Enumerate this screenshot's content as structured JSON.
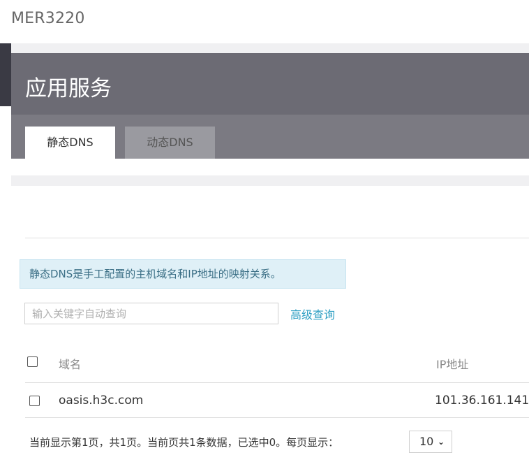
{
  "device": {
    "name": "MER3220"
  },
  "page": {
    "title": "应用服务"
  },
  "tabs": [
    {
      "label": "静态DNS",
      "active": true
    },
    {
      "label": "动态DNS",
      "active": false
    }
  ],
  "info": {
    "text": "静态DNS是手工配置的主机域名和IP地址的映射关系。"
  },
  "search": {
    "placeholder": "输入关键字自动查询",
    "value": "",
    "advanced_label": "高级查询"
  },
  "table": {
    "columns": [
      "域名",
      "IP地址"
    ],
    "rows": [
      {
        "domain": "oasis.h3c.com",
        "ip": "101.36.161.141",
        "checked": false
      }
    ]
  },
  "pager": {
    "summary": "当前显示第1页，共1页。当前页共1条数据，已选中0。每页显示：",
    "page_size": "10",
    "page_size_icon": "chevron-down-icon"
  },
  "colors": {
    "header_bg": "#6c6b74",
    "info_bg": "#dff0f7",
    "link": "#2f9fc3"
  }
}
